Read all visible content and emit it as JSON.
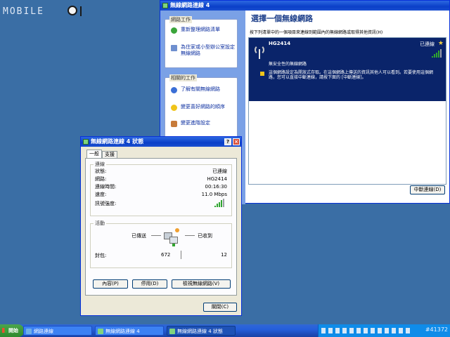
{
  "watermark": {
    "brand": "MOBILE"
  },
  "wireless_window": {
    "title": "無線網路連線 4",
    "tasks_header": "網路工作",
    "task_refresh": "重新整理網路清單",
    "task_setup": "為住家或小型辦公室設定無線網路",
    "related_header": "相關的工作",
    "related_learn": "了解有關無線網路",
    "related_order": "變更喜好網路的順序",
    "related_advanced": "變更進階設定",
    "heading": "選擇一個無線網路",
    "instruction": "按下列清單中的一個項目來連線到範圍內的無線網路或取得其他資訊(H)",
    "network": {
      "ssid": "HG2414",
      "status": "已連線",
      "security": "無安全性的無線網路",
      "warning": "這個網路設定為開放式存取。在這個網路上傳送的資訊其他人可以看到。若要使用這個網路，您可以直接中斷連線，請按下面的 [中斷連線]。",
      "signal_level": 0.8
    },
    "disconnect_button": "中斷連線(D)"
  },
  "status_dialog": {
    "title": "無線網路連線 4 狀態",
    "tabs": [
      "一般",
      "支援"
    ],
    "connection_group": "連線",
    "rows": [
      {
        "label": "狀態:",
        "value": "已連線"
      },
      {
        "label": "網路:",
        "value": "HG2414"
      },
      {
        "label": "連線時間:",
        "value": "00:16:30"
      },
      {
        "label": "速度:",
        "value": "11.0 Mbps"
      }
    ],
    "signal_label": "訊號強度:",
    "signal_level": 0.8,
    "activity_group": "活動",
    "sent_label": "已傳送",
    "received_label": "已收到",
    "packets_label": "封包:",
    "packets_sent": "672",
    "packets_received": "12",
    "properties_button": "內容(P)",
    "disable_button": "停用(D)",
    "view_networks_button": "檢視無線網路(V)",
    "close_button": "關閉(C)"
  },
  "taskbar": {
    "start": "開始",
    "items": [
      "網路連線",
      "無線網路連線 4",
      "無線網路連線 4 狀態"
    ],
    "watermark": "#41372"
  }
}
